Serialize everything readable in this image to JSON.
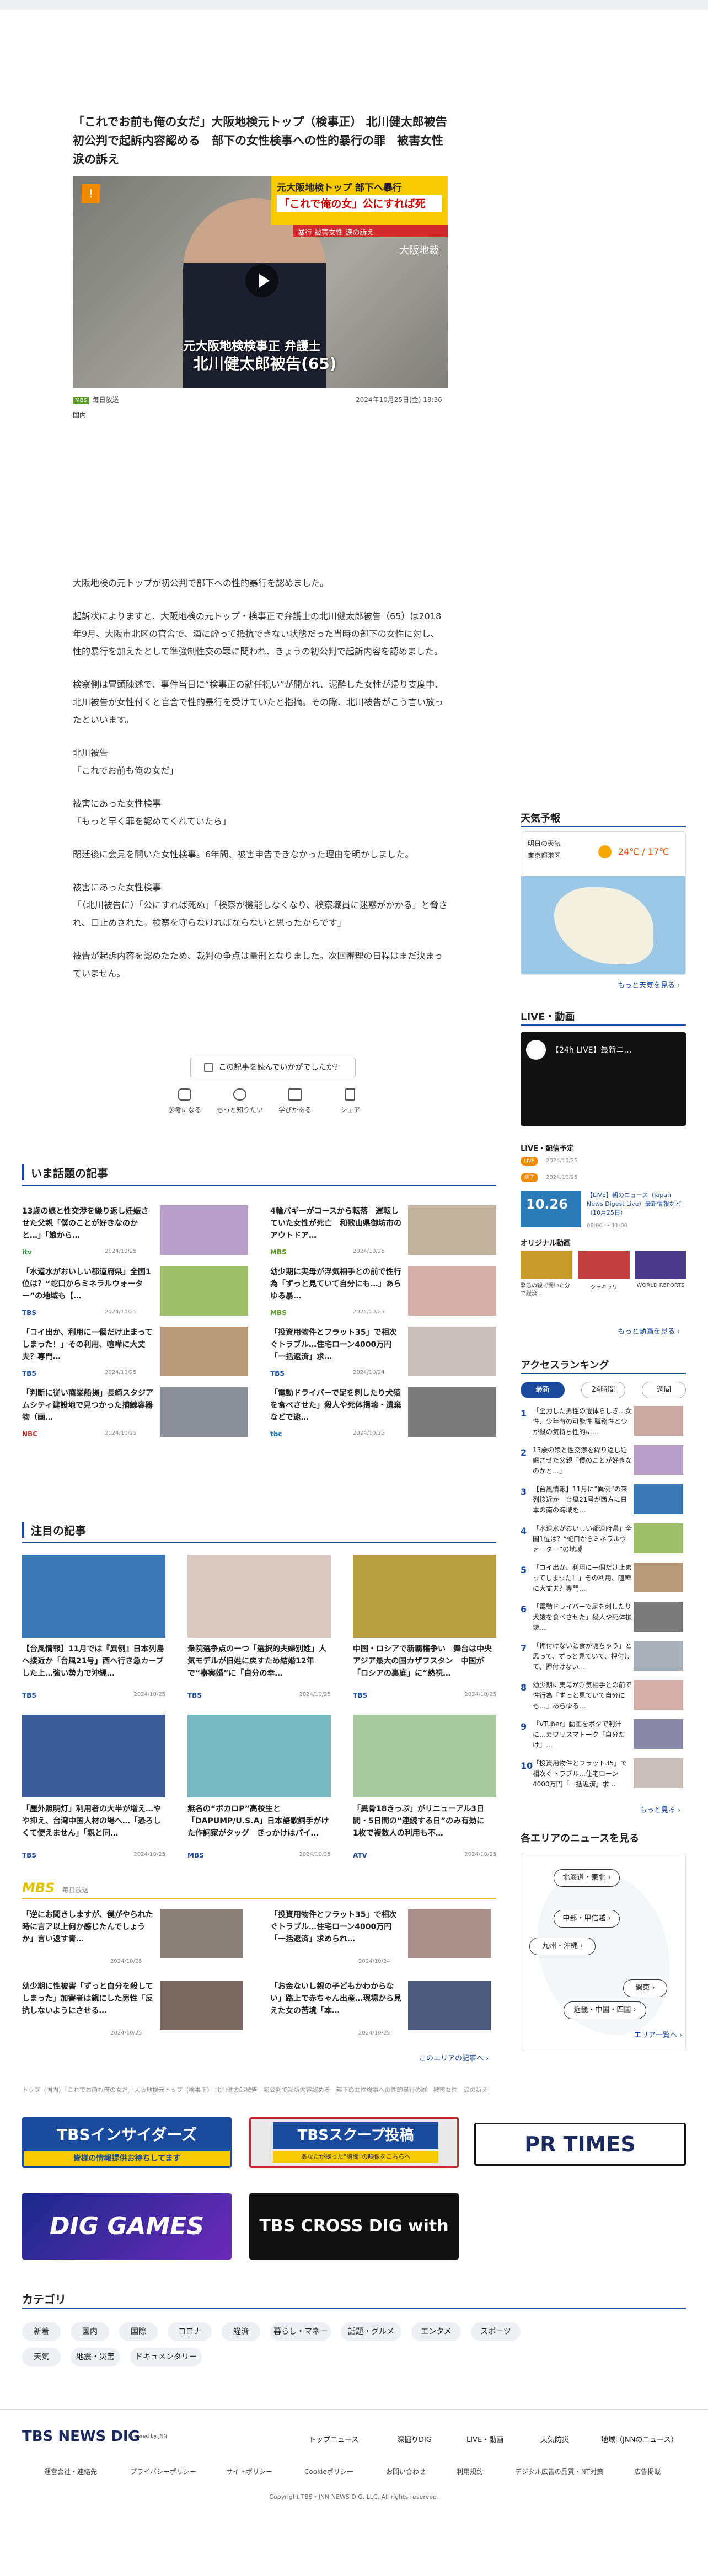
{
  "article": {
    "title": "「これでお前も俺の女だ」大阪地検元トップ（検事正） 北川健太郎被告　初公判で起訴内容認める　部下の女性検事への性的暴行の罪　被害女性　涙の訴え",
    "video": {
      "channel_badge": "!",
      "tag_box_line1": "元大阪地検トップ 部下へ暴行",
      "tag_box_line2": "「これで俺の女」公にすれば死",
      "tag_box_sub": "暴行 被害女性 涙の訴え",
      "time_text": "大阪地裁",
      "caption_line1": "元大阪地検検事正 弁護士",
      "caption_line2": "北川健太郎被告(65)"
    },
    "source_badge": "MBS",
    "source": "毎日放送",
    "date": "2024年10月25日(金) 18:36",
    "category": "国内",
    "paragraphs": [
      "大阪地検の元トップが初公判で部下への性的暴行を認めました。",
      "起訴状によりますと、大阪地検の元トップ・検事正で弁護士の北川健太郎被告（65）は2018年9月、大阪市北区の官舎で、酒に酔って抵抗できない状態だった当時の部下の女性に対し、性的暴行を加えたとして準強制性交の罪に問われ、きょうの初公判で起訴内容を認めました。",
      "検察側は冒頭陳述で、事件当日に“検事正の就任祝い”が開かれ、泥酔した女性が帰り支度中、北川被告が女性付くと官舎で性的暴行を受けていたと指摘。その際、北川被告がこう言い放ったといいます。",
      "北川被告\n「これでお前も俺の女だ」",
      "被害にあった女性検事\n「もっと早く罪を認めてくれていたら」",
      "閉廷後に会見を開いた女性検事。6年間、被害申告できなかった理由を明かしました。",
      "被害にあった女性検事\n「（北川被告に）「公にすれば死ぬ」「検察が機能しなくなり、検察職員に迷惑がかかる」と脅され、口止めされた。検察を守らなければならないと思ったからです」",
      "被告が起訴内容を認めたため、裁判の争点は量刑となりました。次回審理の日程はまだ決まっていません。"
    ],
    "ask_label": "この記事を読んでいかがでしたか？",
    "reactions": [
      "参考になる",
      "もっと知りたい",
      "学びがある",
      "シェア"
    ]
  },
  "hot_topics": {
    "title": "いま話題の記事",
    "items": [
      {
        "title": "13歳の娘と性交渉を繰り返し妊娠させた父親「僕のことが好きなのかと…」「娘から…",
        "label": "itv",
        "label_color": "#2f9e3f",
        "date": "2024/10/25",
        "img": "#b8a0c8"
      },
      {
        "title": "4輪バギーがコースから転落　運転していた女性が死亡　和歌山県御坊市のアウトドア…",
        "label": "MBS",
        "label_color": "#5c9a2b",
        "date": "2024/10/25",
        "img": "#c0b29c"
      },
      {
        "title": "「水道水がおいしい都道府県」全国1位は？“蛇口からミネラルウォーター”の地域も【…",
        "label": "TBS",
        "label_color": "#1a4a9c",
        "date": "2024/10/25",
        "img": "#9fc06a"
      },
      {
        "title": "幼少期に実母が浮気相手との前で性行為「ずっと見ていて自分にも…」あらゆる暴…",
        "label": "MBS",
        "label_color": "#5c9a2b",
        "date": "2024/10/25",
        "img": "#d6b0a8"
      },
      {
        "title": "「コイ出か、利用に一個だけ止まってしまった！」その利用、喧嘩に大丈夫？専門…",
        "label": "TBS",
        "label_color": "#1a4a9c",
        "date": "2024/10/25",
        "img": "#b89a7a"
      },
      {
        "title": "「投資用物件とフラット35」で相次ぐトラブル…住宅ローン4000万円「一括返済」求…",
        "label": "TBS",
        "label_color": "#1a4a9c",
        "date": "2024/10/24",
        "img": "#c8c0b8"
      },
      {
        "title": "「判断に従い商業船揚」長崎スタジアムシティ建設地で見つかった捕鯨容器物（画…",
        "label": "NBC",
        "label_color": "#c02a2a",
        "date": "2024/10/25",
        "img": "#8a8f98"
      },
      {
        "title": "「電動ドライバーで足を刺したり犬猿を食べさせた」殺人や死体損壊・遺棄などで逮…",
        "label": "tbc",
        "label_color": "#1a7ab8",
        "date": "2024/10/25",
        "img": "#7a7a7a"
      }
    ]
  },
  "featured": {
    "title": "注目の記事",
    "items": [
      {
        "title": "【台風情報】11月では『異例』日本列島へ接近か「台風21号」西へ行き急カーブした上…強い勢力で沖縄…",
        "label": "TBS",
        "date": "2024/10/25",
        "img": "#3a78b8"
      },
      {
        "title": "衆院選争点のーつ「選択的夫婦別姓」人気モデルが旧姓に戻すため結婚12年で“事実婚”に「自分の幸…",
        "label": "TBS",
        "date": "2024/10/25",
        "img": "#d8c8c0"
      },
      {
        "title": "中国・ロシアで新覇権争い　舞台は中央アジア最大の国カザフスタン　中国が「ロシアの裏庭」に“熱視…",
        "label": "TBS",
        "date": "2024/10/25",
        "img": "#b8a040"
      },
      {
        "title": "「屋外照明灯」利用者の大半が増え…やや抑え、台湾中国人材の場へ…「恐ろしくて使えません」「親と同…",
        "label": "TBS",
        "date": "2024/10/25",
        "img": "#3a5a98"
      },
      {
        "title": "無名の“ボカロP”高校生と「DAPUMP/U.S.A」日本語歌詞手がけた作詞家がタッグ　きっかけはパイ…",
        "label": "MBS",
        "date": "2024/10/25",
        "img": "#78b8c0"
      },
      {
        "title": "「異骨18きっぷ」がリニューアル3日間・5日間の“連続する日”のみ有効に　1枚で複数人の利用も不…",
        "label": "ATV",
        "date": "2024/10/25",
        "img": "#a8c8a0"
      }
    ]
  },
  "mbs_section": {
    "logo": "MBS",
    "label": "毎日放送",
    "items": [
      {
        "title": "「逆にお聞きしますが、僕がやられた時に言ア以上何か感じたんでしょうか」言い返す青…",
        "date": "2024/10/25",
        "img": "#8a8078"
      },
      {
        "title": "「投資用物件とフラット35」で相次ぐトラブル…住宅ローン4000万円「一括返済」求められ…",
        "date": "2024/10/24",
        "img": "#a89088"
      },
      {
        "title": "幼少期に性被害「ずっと自分を殺してしまった」加害者は親にした男性「反抗しないようにさせる…",
        "date": "2024/10/25",
        "img": "#7a6a60"
      },
      {
        "title": "「お金ないし親の子どもかわからない」路上で赤ちゃん出産…現場から見えた女の苦境「本…",
        "date": "2024/10/25",
        "img": "#4a5a7a"
      }
    ],
    "more": "このエリアの記事へ ›"
  },
  "breadcrumb": "トップ（国内）「これでお前も俺の女だ」大阪地検元トップ（検事正） 北川健太郎被告　初公判で起訴内容認める　部下の女性検事への性的暴行の罪　被害女性　涙の訴え",
  "banners": [
    {
      "text": "TBSインサイダーズ",
      "sub": "皆様の情報提供お待ちしてます",
      "bg": "#1a4a9c"
    },
    {
      "text": "TBSスクープ投稿",
      "sub": "あなたが撮った“瞬間”の映像をこちらへ",
      "bg": "#1a4a9c"
    },
    {
      "text": "PR TIMES",
      "sub": "",
      "bg": "#fff"
    },
    {
      "text": "DIG GAMES",
      "sub": "",
      "bg": "#3a2a8a"
    },
    {
      "text": "TBS CROSS DIG with Bloomberg",
      "sub": "",
      "bg": "#111"
    }
  ],
  "categories": {
    "title": "カテゴリ",
    "items": [
      "新着",
      "国内",
      "国際",
      "コロナ",
      "経済",
      "暮らし・マネー",
      "話題・グルメ",
      "エンタメ",
      "スポーツ",
      "天気",
      "地震・災害",
      "ドキュメンタリー"
    ]
  },
  "footer": {
    "logo": "TBS NEWS DIG",
    "powered": "Powered by JNN",
    "nav": [
      "トップニュース",
      "深掘りDIG",
      "LIVE・動画",
      "天気防災",
      "地域（JNNのニュース）"
    ],
    "sub": [
      "運営会社・連絡先",
      "プライバシーポリシー",
      "サイトポリシー",
      "Cookieポリシー",
      "お問い合わせ",
      "利用規約",
      "デジタル広告の品質・NT対策",
      "広告掲載"
    ],
    "copyright": "Copyright TBS・JNN NEWS DIG, LLC. All rights reserved."
  },
  "sidebar": {
    "weather_title": "天気予報",
    "weather_day": "明日の天気",
    "weather_city": "東京都港区",
    "weather_temp": "24℃ / 17℃",
    "weather_more": "もっと天気を見る ›",
    "live_title": "LIVE・動画",
    "live_video_title": "【24h LIVE】最新ニ…",
    "live_schedule_title": "LIVE・配信予定",
    "live_items": [
      {
        "badge": "LIVE",
        "date": "2024/10/25",
        "title": "【LIVE】朝のニュース（Japan News Digest Live）最新情報など（10月25日）",
        "time": "06:00 ～ 11:00"
      },
      {
        "badge": "終了",
        "date": "2024/10/25",
        "title": "",
        "time": ""
      }
    ],
    "original_title": "オリジナル動画",
    "original_items": [
      "緊急の殺で開いた分で経済…",
      "シャキッリ",
      "WORLD REPORTS"
    ],
    "original_more": "もっと動画を見る ›",
    "ranking_title": "アクセスランキング",
    "ranking_tabs": [
      "最新",
      "24時間",
      "週間"
    ],
    "ranking": [
      "「全力した男性の遺体らしき…女性、少年有の可能性 職務性と少が殺の気持ち性的に…",
      "13歳の娘と性交渉を繰り返し妊娠させた父親「僕のことが好きなのかと…」",
      "【台風情報】11月に“異例”の来列接近か　台風21号が西方に日本の南の海域を…",
      "「水道水がおいしい都道府県」全国1位は？“蛇口からミネラルウォーター”の地域",
      "「コイ出か、利用に一個だけ止まってしまった！」その利用、喧嘩に大丈夫？専門…",
      "「電動ドライバーで足を刺したり犬猿を食べさせた」殺人や死体損壊…",
      "「押付けないと食が隠ちゃう」と思って、ずっと見ていて、押付けて、押付けない…",
      "幼少期に実母が浮気相手との前で性行為「ずっと見ていて自分にも…」あらゆる…",
      "「VTuber」動画をボタで制汁に…カワリスマトーク「自分だけ」…",
      "「投資用物件とフラット35」で相次ぐトラブル…住宅ローン4000万円「一括返済」求…"
    ],
    "ranking_more": "もっと見る ›",
    "area_title": "各エリアのニュースを見る",
    "areas": [
      "北海道・東北 ›",
      "中部・甲信越 ›",
      "九州・沖縄 ›",
      "関東 ›",
      "近畿・中国・四国 ›"
    ],
    "area_more": "エリア一覧へ ›"
  }
}
